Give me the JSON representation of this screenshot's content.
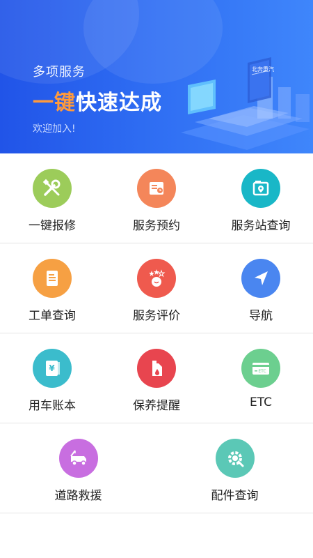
{
  "banner": {
    "subtitle": "多项服务",
    "title_highlight": "一键",
    "title_rest": "快速达成",
    "welcome": "欢迎加入!",
    "sign_text": "北奔重汽",
    "colors": {
      "gradient_start": "#2154e8",
      "gradient_end": "#3f86fb",
      "highlight": "#ff9a3c"
    }
  },
  "grid": {
    "rows": [
      [
        {
          "label": "一键报修",
          "icon": "wrench-screwdriver-icon",
          "color": "#9ccc5a"
        },
        {
          "label": "服务预约",
          "icon": "appointment-icon",
          "color": "#f4865a"
        },
        {
          "label": "服务站查询",
          "icon": "station-location-icon",
          "color": "#19b7c7"
        }
      ],
      [
        {
          "label": "工单查询",
          "icon": "work-order-icon",
          "color": "#f6a043"
        },
        {
          "label": "服务评价",
          "icon": "rating-icon",
          "color": "#ef5a4e"
        },
        {
          "label": "导航",
          "icon": "navigation-arrow-icon",
          "color": "#4a86f0"
        }
      ],
      [
        {
          "label": "用车账本",
          "icon": "ledger-icon",
          "color": "#3bbccc"
        },
        {
          "label": "保养提醒",
          "icon": "oil-can-icon",
          "color": "#e8454f"
        },
        {
          "label": "ETC",
          "icon": "etc-card-icon",
          "color": "#6ccf8f"
        }
      ],
      [
        {
          "label": "道路救援",
          "icon": "tow-truck-icon",
          "color": "#c86ee0"
        },
        {
          "label": "配件查询",
          "icon": "parts-gear-icon",
          "color": "#5bc8b6"
        }
      ]
    ],
    "etc_card_text": "ETC"
  }
}
